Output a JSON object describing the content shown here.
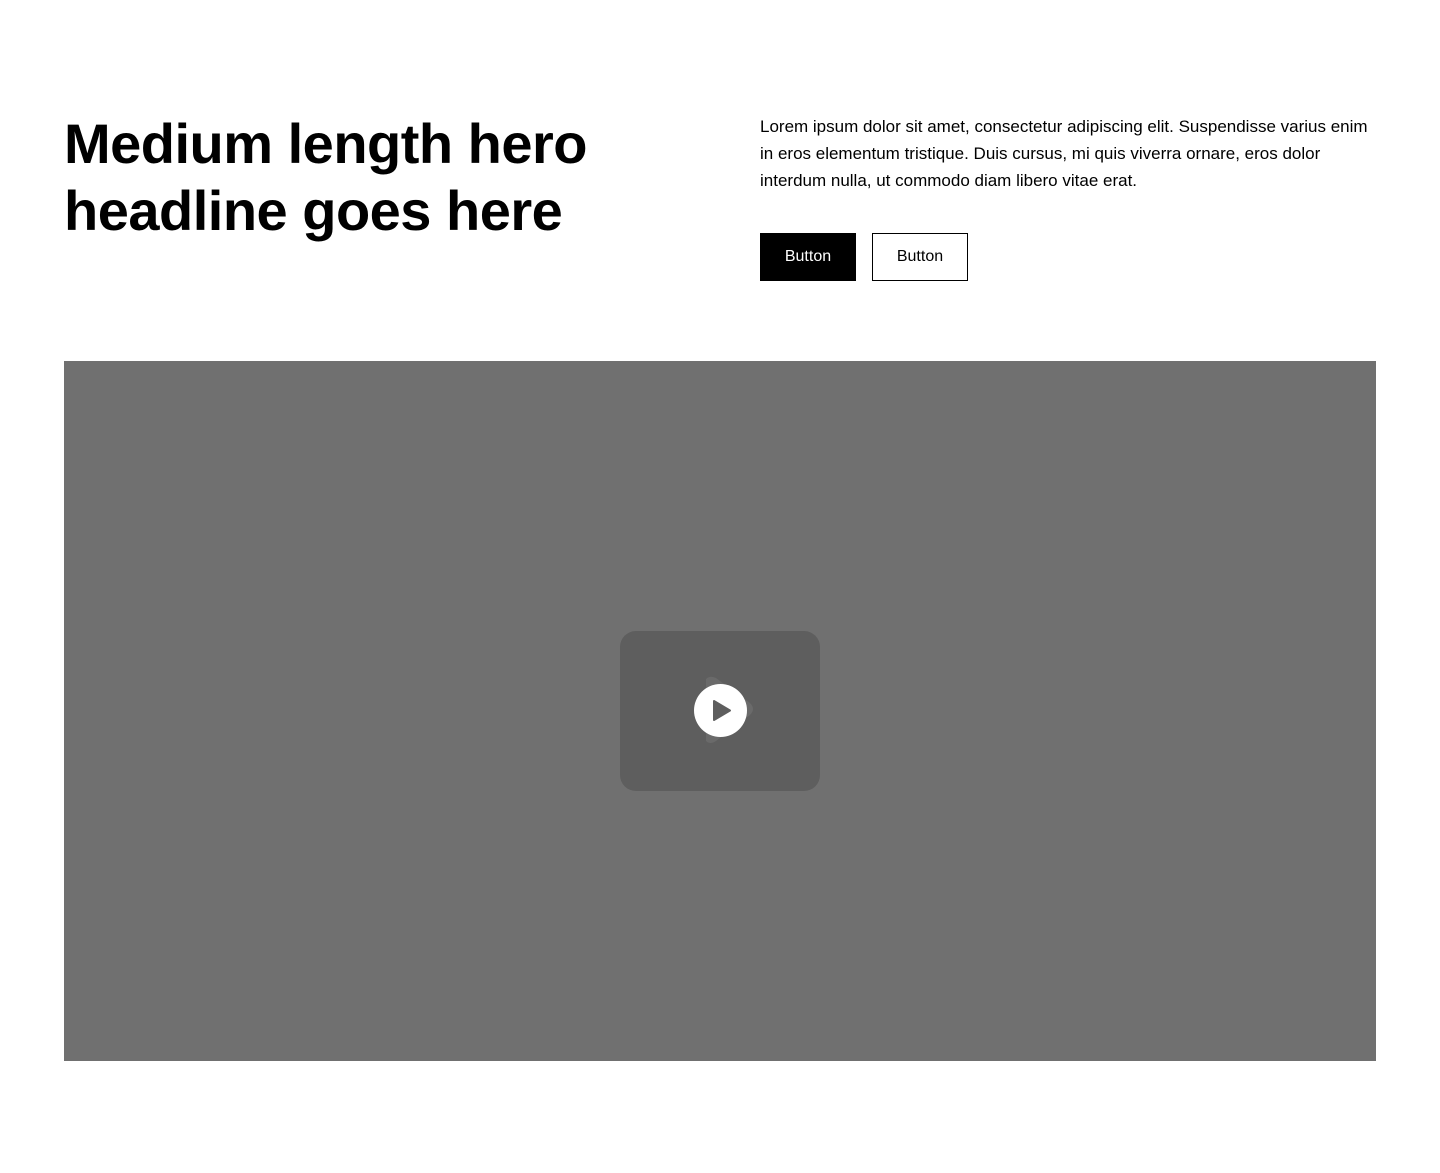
{
  "hero": {
    "headline": "Medium length hero headline goes here",
    "body": "Lorem ipsum dolor sit amet, consectetur adipiscing elit. Suspendisse varius enim in eros elementum tristique. Duis cursus, mi quis viverra ornare, eros dolor interdum nulla, ut commodo diam libero vitae erat.",
    "primary_button_label": "Button",
    "secondary_button_label": "Button"
  },
  "video": {
    "background_color": "#707070",
    "card_color": "#5e5e5e",
    "icon": "play-icon"
  }
}
